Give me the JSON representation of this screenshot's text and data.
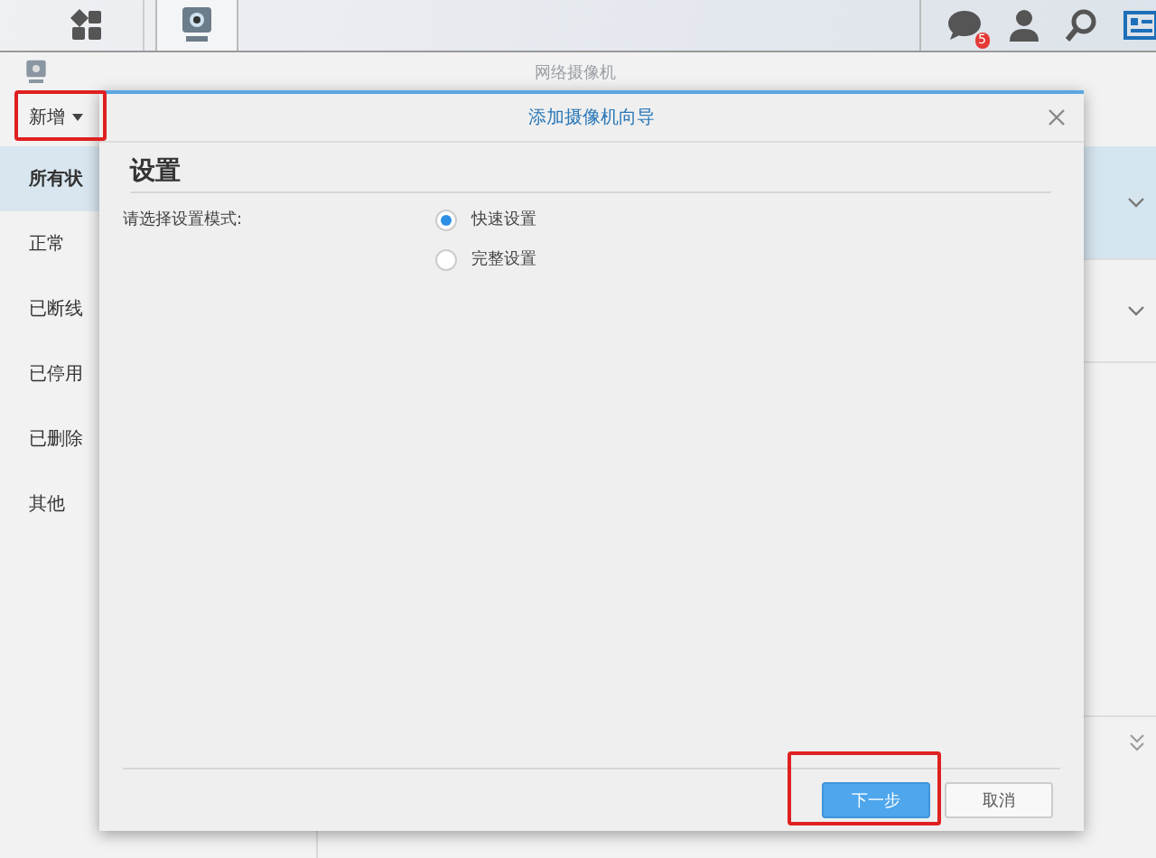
{
  "taskbar": {
    "notification_badge": "5"
  },
  "window": {
    "title": "网络摄像机"
  },
  "toolbar": {
    "add_button": "新增"
  },
  "sidebar": {
    "items": [
      {
        "label": "所有状",
        "selected": true
      },
      {
        "label": "正常",
        "selected": false
      },
      {
        "label": "已断线",
        "selected": false
      },
      {
        "label": "已停用",
        "selected": false
      },
      {
        "label": "已删除",
        "selected": false
      },
      {
        "label": "其他",
        "selected": false
      }
    ]
  },
  "list": {
    "rows": [
      {
        "selected": true
      },
      {
        "selected": false
      }
    ]
  },
  "dialog": {
    "title": "添加摄像机向导",
    "heading": "设置",
    "field_label": "请选择设置模式:",
    "options": [
      {
        "label": "快速设置",
        "selected": true
      },
      {
        "label": "完整设置",
        "selected": false
      }
    ],
    "buttons": [
      {
        "label": "下一步",
        "kind": "primary"
      },
      {
        "label": "取消",
        "kind": "secondary"
      }
    ]
  }
}
